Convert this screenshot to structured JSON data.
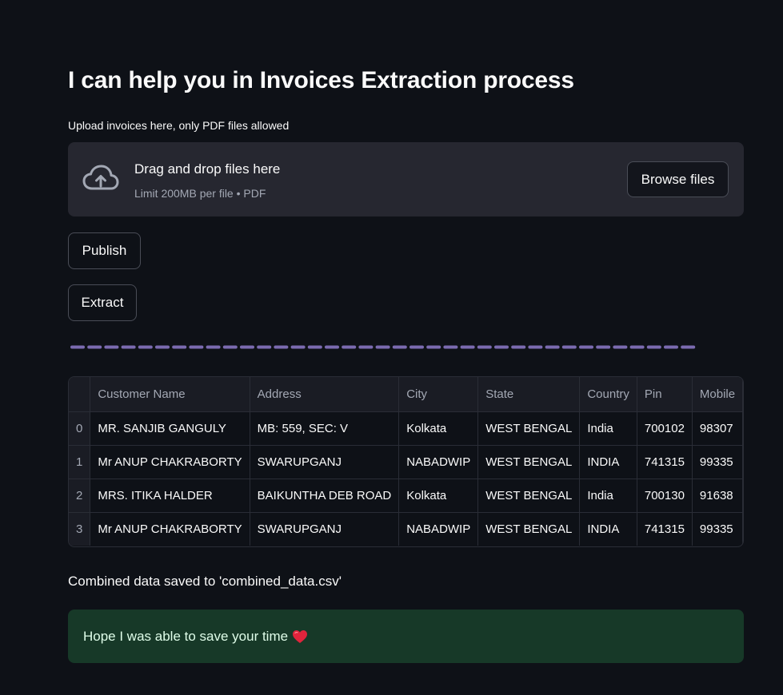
{
  "title": "I can help you in Invoices Extraction process",
  "uploader": {
    "label": "Upload invoices here, only PDF files allowed",
    "dropzone_title": "Drag and drop files here",
    "dropzone_subtitle": "Limit 200MB per file • PDF",
    "browse_label": "Browse files",
    "icon": "cloud-upload-icon"
  },
  "buttons": {
    "publish": "Publish",
    "extract": "Extract"
  },
  "colors": {
    "background": "#0e1117",
    "divider": "#7b6bb0",
    "success_bg": "#173928"
  },
  "table": {
    "columns": [
      "",
      "Customer Name",
      "Address",
      "City",
      "State",
      "Country",
      "Pin",
      "Mobile"
    ],
    "rows": [
      [
        "0",
        "MR. SANJIB GANGULY",
        "MB: 559, SEC: V",
        "Kolkata",
        "WEST BENGAL",
        "India",
        "700102",
        "98307"
      ],
      [
        "1",
        "Mr ANUP CHAKRABORTY",
        "SWARUPGANJ",
        "NABADWIP",
        "WEST BENGAL",
        "INDIA",
        "741315",
        "99335"
      ],
      [
        "2",
        "MRS. ITIKA HALDER",
        "BAIKUNTHA DEB ROAD",
        "Kolkata",
        "WEST BENGAL",
        "India",
        "700130",
        "91638"
      ],
      [
        "3",
        "Mr ANUP CHAKRABORTY",
        "SWARUPGANJ",
        "NABADWIP",
        "WEST BENGAL",
        "INDIA",
        "741315",
        "99335"
      ]
    ]
  },
  "saved_message": "Combined data saved to 'combined_data.csv'",
  "success_message": "Hope I was able to save your time",
  "success_icon": "heart-icon"
}
